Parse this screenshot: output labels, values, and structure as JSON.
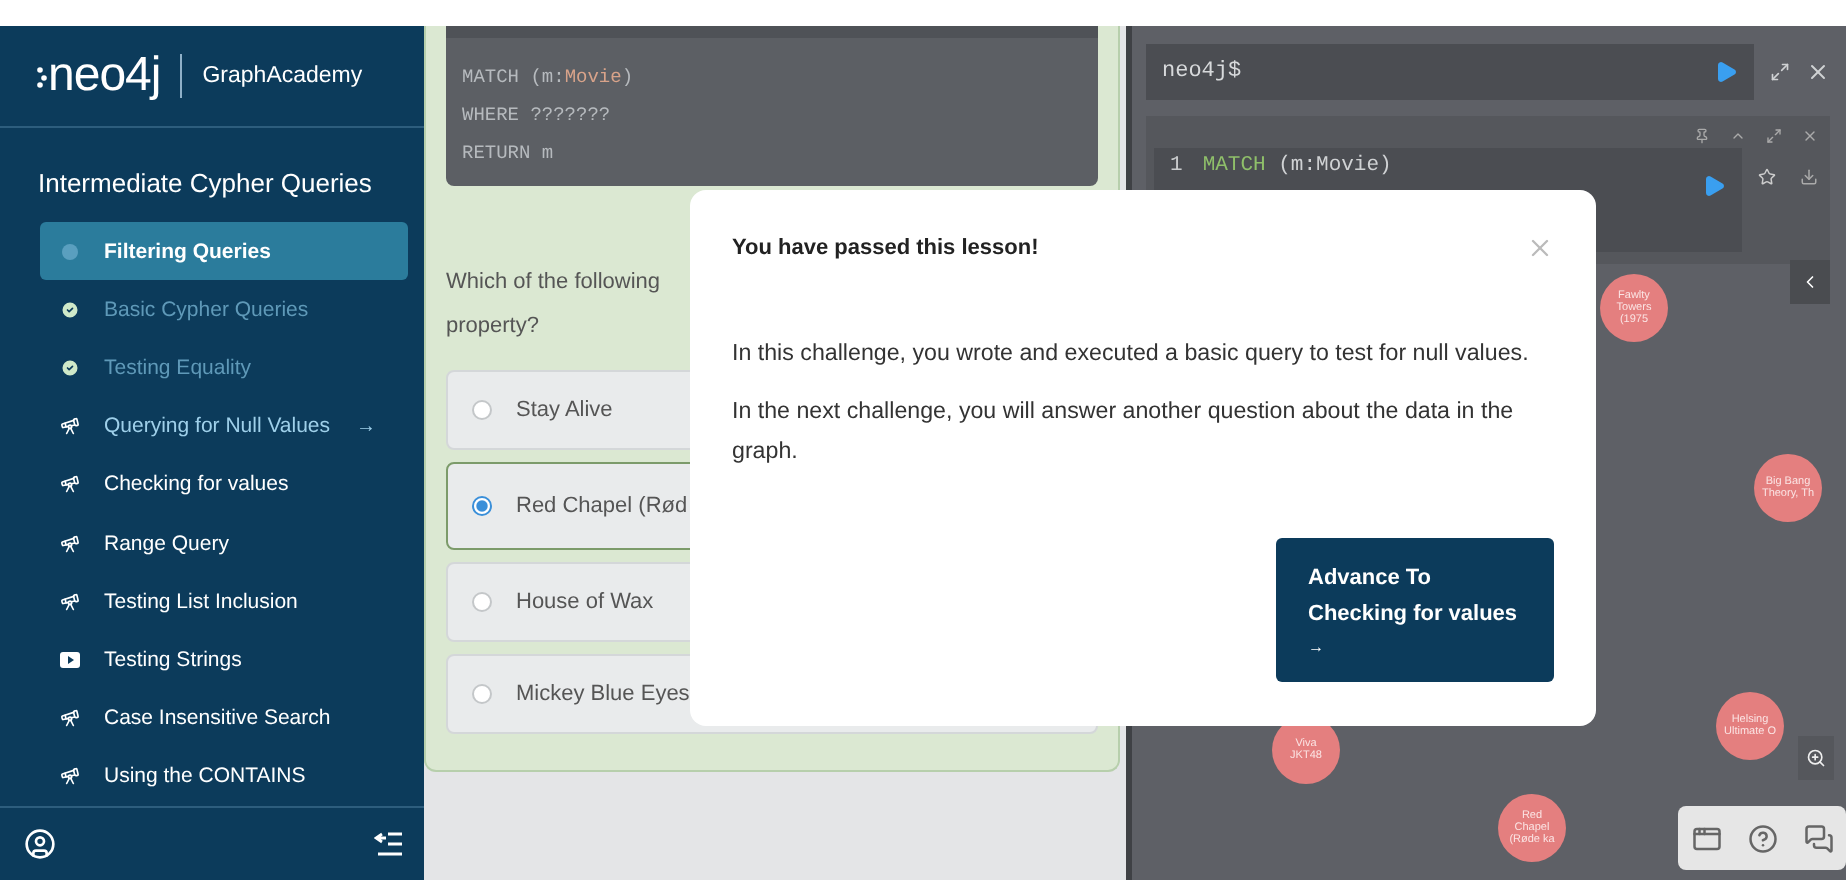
{
  "sidebar": {
    "logo": "neo4j",
    "brand": "GraphAcademy",
    "course_title": "Intermediate Cypher Queries",
    "items": [
      {
        "label": "Filtering Queries",
        "kind": "dot",
        "selected": true,
        "completed": false,
        "current": false
      },
      {
        "label": "Basic Cypher Queries",
        "kind": "check",
        "selected": false,
        "completed": true,
        "current": false
      },
      {
        "label": "Testing Equality",
        "kind": "check",
        "selected": false,
        "completed": true,
        "current": false
      },
      {
        "label": "Querying for Null Values",
        "kind": "challenge",
        "selected": false,
        "completed": false,
        "current": true,
        "arrow": "→"
      },
      {
        "label": "Checking for values",
        "kind": "challenge",
        "selected": false,
        "completed": false,
        "current": false
      },
      {
        "label": "Range Query",
        "kind": "challenge",
        "selected": false,
        "completed": false,
        "current": false
      },
      {
        "label": "Testing List Inclusion",
        "kind": "challenge",
        "selected": false,
        "completed": false,
        "current": false
      },
      {
        "label": "Testing Strings",
        "kind": "video",
        "selected": false,
        "completed": false,
        "current": false
      },
      {
        "label": "Case Insensitive Search",
        "kind": "challenge",
        "selected": false,
        "completed": false,
        "current": false
      },
      {
        "label": "Using the CONTAINS",
        "kind": "challenge",
        "selected": false,
        "completed": false,
        "current": false
      }
    ]
  },
  "lesson": {
    "code": [
      [
        {
          "text": "MATCH (m:",
          "kind": "plain"
        },
        {
          "text": "Movie",
          "kind": "label"
        },
        {
          "text": ")",
          "kind": "plain"
        }
      ],
      [
        {
          "text": "WHERE ???????",
          "kind": "plain"
        }
      ],
      [
        {
          "text": "RETURN m",
          "kind": "plain"
        }
      ]
    ],
    "question_lines": [
      "Which of the following",
      "property?"
    ],
    "options": [
      {
        "label": "Stay Alive",
        "selected": false
      },
      {
        "label": "Red Chapel (Rød",
        "selected": true
      },
      {
        "label": "House of Wax",
        "selected": false
      },
      {
        "label": "Mickey Blue Eyes",
        "selected": false
      }
    ]
  },
  "browser": {
    "prompt": "neo4j$",
    "query": {
      "line_number": "1",
      "tokens": [
        {
          "text": "MATCH",
          "kind": "keyword"
        },
        {
          "text": " (m:Movie)",
          "kind": "plain"
        }
      ]
    },
    "nodes": [
      {
        "label": "Fawlty Towers (1975"
      },
      {
        "label": "Big Bang Theory, Th"
      },
      {
        "label": "Helsing Ultimate O"
      },
      {
        "label": "Viva JKT48"
      },
      {
        "label": "Red Chapel (Røde ka"
      }
    ]
  },
  "modal": {
    "title": "You have passed this lesson!",
    "paragraphs": [
      "In this challenge, you wrote and executed a basic query to test for null values.",
      "In the next challenge, you will answer another question about the data in the graph."
    ],
    "button_lines": [
      "Advance To",
      "Checking for values",
      "→"
    ]
  }
}
